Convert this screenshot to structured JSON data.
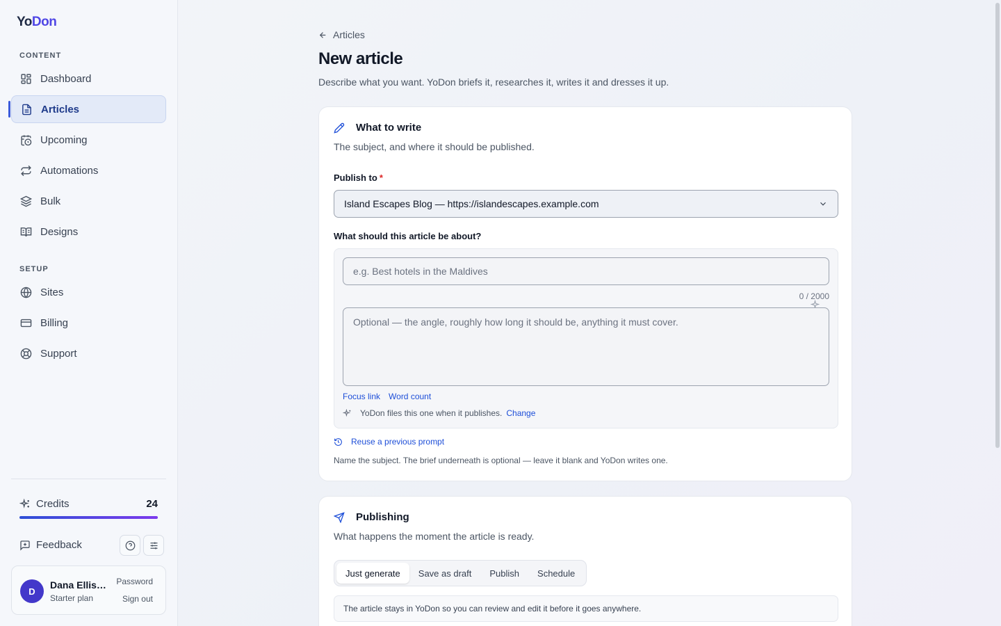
{
  "brand": {
    "name_part1": "Yo",
    "name_part2": "Don"
  },
  "sidebar": {
    "sections": [
      {
        "label": "CONTENT"
      },
      {
        "label": "SETUP"
      }
    ],
    "items": [
      {
        "label": "Dashboard",
        "icon": "dashboard-icon"
      },
      {
        "label": "Articles",
        "icon": "document-icon",
        "active": true
      },
      {
        "label": "Upcoming",
        "icon": "calendar-clock-icon"
      },
      {
        "label": "Automations",
        "icon": "repeat-icon"
      },
      {
        "label": "Bulk",
        "icon": "layers-icon"
      },
      {
        "label": "Designs",
        "icon": "book-open-icon"
      },
      {
        "label": "Sites",
        "icon": "globe-icon"
      },
      {
        "label": "Billing",
        "icon": "credit-card-icon"
      },
      {
        "label": "Support",
        "icon": "life-buoy-icon"
      }
    ],
    "credits": {
      "label": "Credits",
      "count": "24"
    },
    "feedback": {
      "label": "Feedback"
    },
    "user": {
      "initial": "D",
      "name": "Dana Ellis…",
      "plan": "Starter plan",
      "password_link": "Password",
      "signout_link": "Sign out"
    }
  },
  "main": {
    "back_label": "Articles",
    "title": "New article",
    "subtitle": "Describe what you want. YoDon briefs it, researches it, writes it and dresses it up.",
    "what_card": {
      "title": "What to write",
      "subtitle": "The subject, and where it should be published.",
      "publish_label": "Publish to",
      "publish_required": "*",
      "publish_value": "Island Escapes Blog — https://islandescapes.example.com",
      "about_label": "What should this article be about?",
      "subject_placeholder": "e.g. Best hotels in the Maldives",
      "counter": "0 / 2000",
      "brief_placeholder": "Optional — the angle, roughly how long it should be, anything it must cover.",
      "focus_link": "Focus link",
      "word_count_link": "Word count",
      "files_text": "YoDon files this one when it publishes.",
      "change_link": "Change",
      "reuse_link": "Reuse a previous prompt",
      "hint": "Name the subject. The brief underneath is optional — leave it blank and YoDon writes one."
    },
    "publishing_card": {
      "title": "Publishing",
      "subtitle": "What happens the moment the article is ready.",
      "options": [
        "Just generate",
        "Save as draft",
        "Publish",
        "Schedule"
      ],
      "selected": "Just generate",
      "note": "The article stays in YoDon so you can review and edit it before it goes anywhere."
    }
  },
  "colors": {
    "accent": "#4f46e5",
    "link": "#1d4ed8",
    "required": "#dc2626"
  }
}
